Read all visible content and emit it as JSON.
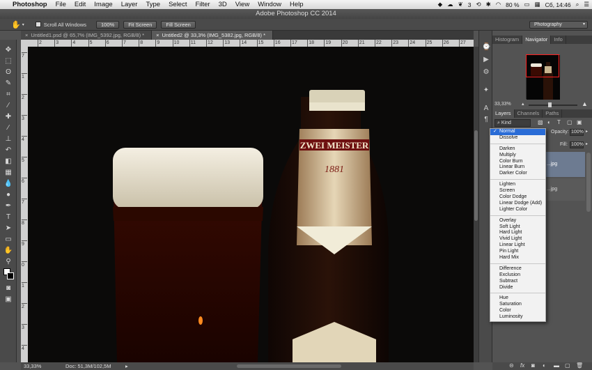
{
  "menubar": {
    "apple": "",
    "app": "Photoshop",
    "items": [
      "File",
      "Edit",
      "Image",
      "Layer",
      "Type",
      "Select",
      "Filter",
      "3D",
      "View",
      "Window",
      "Help"
    ],
    "status": {
      "badge": "3",
      "battery": "80 %",
      "clock": "Сб, 14:46"
    }
  },
  "window": {
    "title": "Adobe Photoshop CC 2014"
  },
  "options": {
    "scroll_all": "Scroll All Windows",
    "btn_100": "100%",
    "fit_screen": "Fit Screen",
    "fill_screen": "Fill Screen",
    "workspace": "Photography"
  },
  "tabs": [
    {
      "label": "Untitled1.psd @ 65,7% (IMG_5392.jpg, RGB/8) *"
    },
    {
      "label": "Untitled2 @ 33,3% (IMG_5382.jpg, RGB/8) *"
    }
  ],
  "ruler_h": [
    "2",
    "3",
    "4",
    "5",
    "6",
    "7",
    "8",
    "9",
    "10",
    "11",
    "12",
    "13",
    "14",
    "15",
    "16",
    "17",
    "18",
    "19",
    "20",
    "21",
    "22",
    "23",
    "24",
    "25",
    "26",
    "27"
  ],
  "ruler_v": [
    "7",
    "1",
    "2",
    "3",
    "4",
    "5",
    "6",
    "7",
    "8",
    "9",
    "0",
    "1",
    "2",
    "3",
    "4"
  ],
  "canvas": {
    "label_brand": "ZWEI MEISTER",
    "label_year": "1881"
  },
  "status": {
    "zoom": "33,33%",
    "doc": "Doc: 51,3M/102,5M"
  },
  "panel_top": {
    "tabs": [
      "Histogram",
      "Navigator",
      "Info"
    ],
    "zoom": "33,33%"
  },
  "panel_layers": {
    "tabs": [
      "Layers",
      "Channels",
      "Paths"
    ],
    "kind": "Kind",
    "opacity_label": "Opacity:",
    "opacity_value": "100%",
    "fill_label": "Fill:",
    "fill_value": "100%",
    "layer1_name": "...jpg",
    "layer2_name": "...jpg"
  },
  "blend_modes": [
    [
      "Normal",
      "Dissolve"
    ],
    [
      "Darken",
      "Multiply",
      "Color Burn",
      "Linear Burn",
      "Darker Color"
    ],
    [
      "Lighten",
      "Screen",
      "Color Dodge",
      "Linear Dodge (Add)",
      "Lighter Color"
    ],
    [
      "Overlay",
      "Soft Light",
      "Hard Light",
      "Vivid Light",
      "Linear Light",
      "Pin Light",
      "Hard Mix"
    ],
    [
      "Difference",
      "Exclusion",
      "Subtract",
      "Divide"
    ],
    [
      "Hue",
      "Saturation",
      "Color",
      "Luminosity"
    ]
  ],
  "selected_blend": "Normal",
  "accent": "#2a6cd6"
}
